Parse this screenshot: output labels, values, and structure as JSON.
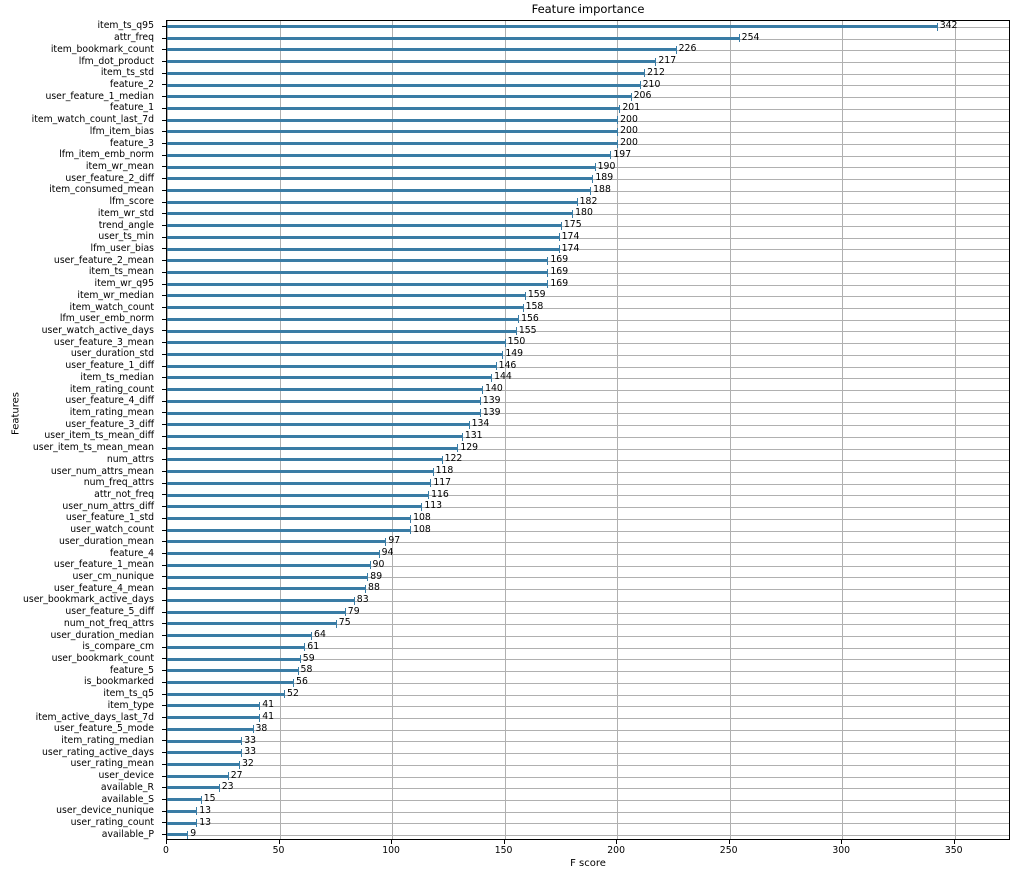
{
  "chart_data": {
    "type": "bar",
    "orientation": "horizontal",
    "title": "Feature importance",
    "xlabel": "F score",
    "ylabel": "Features",
    "xlim": [
      0,
      375
    ],
    "xticks": [
      0,
      50,
      100,
      150,
      200,
      250,
      300,
      350
    ],
    "grid": true,
    "legend": null,
    "bar_color": "#3a7ca5",
    "grid_color": "#b0b0b0",
    "categories": [
      "item_ts_q95",
      "attr_freq",
      "item_bookmark_count",
      "lfm_dot_product",
      "item_ts_std",
      "feature_2",
      "user_feature_1_median",
      "feature_1",
      "item_watch_count_last_7d",
      "lfm_item_bias",
      "feature_3",
      "lfm_item_emb_norm",
      "item_wr_mean",
      "user_feature_2_diff",
      "item_consumed_mean",
      "lfm_score",
      "item_wr_std",
      "trend_angle",
      "user_ts_min",
      "lfm_user_bias",
      "user_feature_2_mean",
      "item_ts_mean",
      "item_wr_q95",
      "item_wr_median",
      "item_watch_count",
      "lfm_user_emb_norm",
      "user_watch_active_days",
      "user_feature_3_mean",
      "user_duration_std",
      "user_feature_1_diff",
      "item_ts_median",
      "item_rating_count",
      "user_feature_4_diff",
      "item_rating_mean",
      "user_feature_3_diff",
      "user_item_ts_mean_diff",
      "user_item_ts_mean_mean",
      "num_attrs",
      "user_num_attrs_mean",
      "num_freq_attrs",
      "attr_not_freq",
      "user_num_attrs_diff",
      "user_feature_1_std",
      "user_watch_count",
      "user_duration_mean",
      "feature_4",
      "user_feature_1_mean",
      "user_cm_nunique",
      "user_feature_4_mean",
      "user_bookmark_active_days",
      "user_feature_5_diff",
      "num_not_freq_attrs",
      "user_duration_median",
      "is_compare_cm",
      "user_bookmark_count",
      "feature_5",
      "is_bookmarked",
      "item_ts_q5",
      "item_type",
      "item_active_days_last_7d",
      "user_feature_5_mode",
      "item_rating_median",
      "user_rating_active_days",
      "user_rating_mean",
      "user_device",
      "available_R",
      "available_S",
      "user_device_nunique",
      "user_rating_count",
      "available_P"
    ],
    "values": [
      342,
      254,
      226,
      217,
      212,
      210,
      206,
      201,
      200,
      200,
      200,
      197,
      190,
      189,
      188,
      182,
      180,
      175,
      174,
      174,
      169,
      169,
      169,
      159,
      158,
      156,
      155,
      150,
      149,
      146,
      144,
      140,
      139,
      139,
      134,
      131,
      129,
      122,
      118,
      117,
      116,
      113,
      108,
      108,
      97,
      94,
      90,
      89,
      88,
      83,
      79,
      75,
      64,
      61,
      59,
      58,
      56,
      52,
      41,
      41,
      38,
      33,
      33,
      32,
      27,
      23,
      15,
      13,
      13,
      9
    ]
  }
}
